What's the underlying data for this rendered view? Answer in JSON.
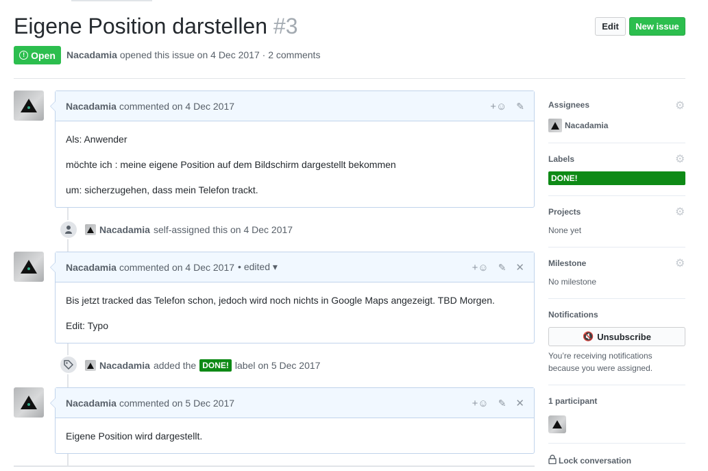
{
  "issue": {
    "title": "Eigene Position darstellen",
    "number": "#3",
    "state": "Open",
    "author": "Nacadamia",
    "meta_rest": "opened this issue on 4 Dec 2017 · 2 comments"
  },
  "header_buttons": {
    "edit": "Edit",
    "new_issue": "New issue"
  },
  "comments": [
    {
      "author": "Nacadamia",
      "meta": "commented on 4 Dec 2017",
      "lines": [
        "Als: Anwender",
        "möchte ich : meine eigene Position auf dem Bildschirm dargestellt bekommen",
        "um: sicherzugehen, dass mein Telefon trackt."
      ]
    },
    {
      "author": "Nacadamia",
      "meta": "commented on 4 Dec 2017",
      "edited": "• edited ▾",
      "lines": [
        "Bis jetzt tracked das Telefon schon, jedoch wird noch nichts in Google Maps angezeigt. TBD Morgen.",
        "Edit: Typo"
      ]
    },
    {
      "author": "Nacadamia",
      "meta": "commented on 5 Dec 2017",
      "lines": [
        "Eigene Position wird dargestellt."
      ]
    }
  ],
  "events": [
    {
      "actor": "Nacadamia",
      "text": "self-assigned this on 4 Dec 2017"
    },
    {
      "actor": "Nacadamia",
      "text_before": "added the",
      "label": "DONE!",
      "text_after": "label on 5 Dec 2017"
    }
  ],
  "icons": {
    "reaction": "smiley-icon",
    "edit": "pencil-icon",
    "delete": "close-icon",
    "assign": "person-icon",
    "label": "tag-icon"
  },
  "sidebar": {
    "assignees": {
      "heading": "Assignees",
      "value": "Nacadamia"
    },
    "labels": {
      "heading": "Labels",
      "value": "DONE!"
    },
    "projects": {
      "heading": "Projects",
      "value": "None yet"
    },
    "milestone": {
      "heading": "Milestone",
      "value": "No milestone"
    },
    "notifications": {
      "heading": "Notifications",
      "button": "Unsubscribe",
      "note": "You’re receiving notifications because you were assigned."
    },
    "participants": {
      "heading": "1 participant"
    },
    "lock": "Lock conversation"
  },
  "colors": {
    "green": "#2cbe4e",
    "label_done": "#0e8a16",
    "comment_head": "#f1f8ff",
    "comment_border": "#c0d3eb"
  }
}
